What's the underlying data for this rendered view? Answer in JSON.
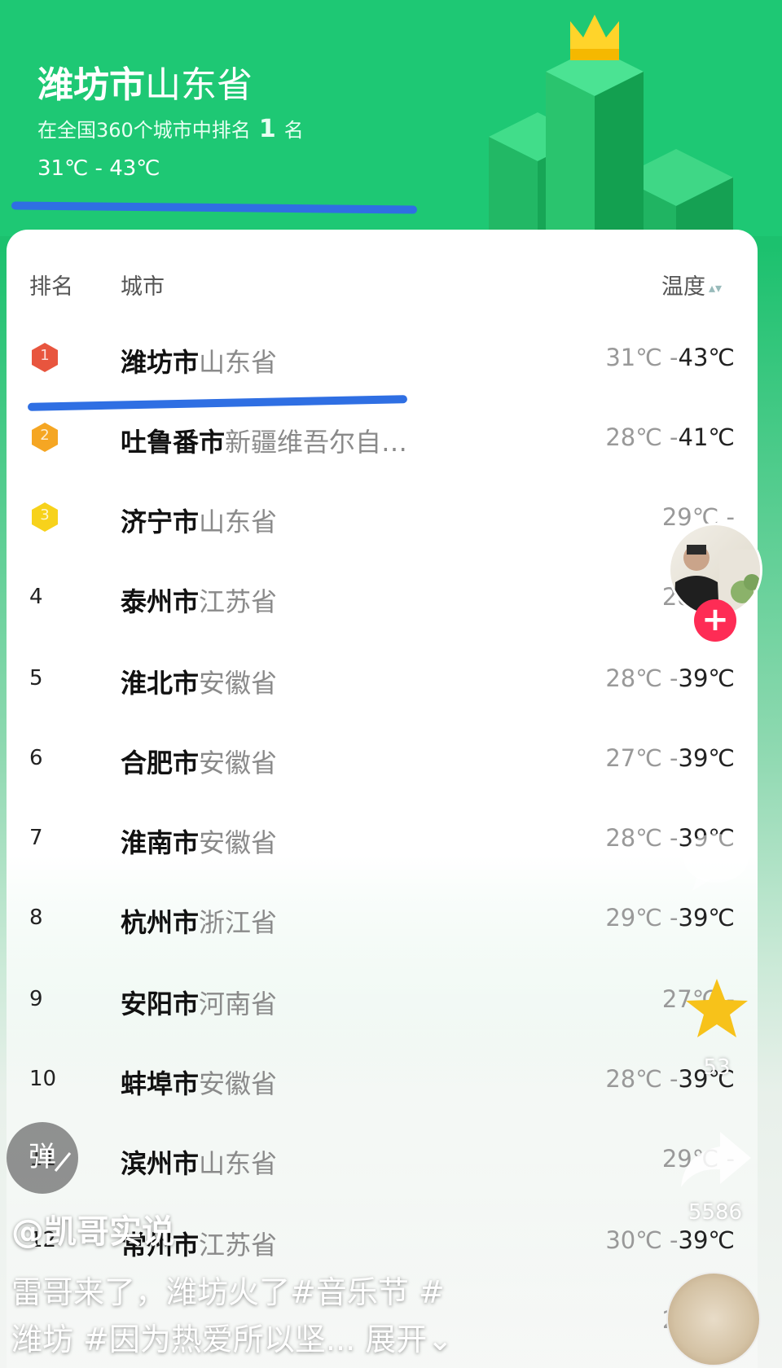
{
  "header": {
    "city": "潍坊市",
    "province": "山东省",
    "rank_prefix": "在全国360个城市中排名",
    "rank_value": "1",
    "rank_suffix": "名",
    "temp_range": "31℃ - 43℃"
  },
  "table": {
    "headers": {
      "rank": "排名",
      "city": "城市",
      "temp": "温度"
    },
    "rows": [
      {
        "rank": "1",
        "city": "潍坊市",
        "province": "山东省",
        "low": "31℃ -",
        "high": "43℃",
        "medal": "#e8553e"
      },
      {
        "rank": "2",
        "city": "吐鲁番市",
        "province": "新疆维吾尔自…",
        "low": "28℃ -",
        "high": "41℃",
        "medal": "#f5a623"
      },
      {
        "rank": "3",
        "city": "济宁市",
        "province": "山东省",
        "low": "29℃ -",
        "high": "",
        "medal": "#f7d21b"
      },
      {
        "rank": "4",
        "city": "泰州市",
        "province": "江苏省",
        "low": "28℃ -",
        "high": ""
      },
      {
        "rank": "5",
        "city": "淮北市",
        "province": "安徽省",
        "low": "28℃ -",
        "high": "39℃"
      },
      {
        "rank": "6",
        "city": "合肥市",
        "province": "安徽省",
        "low": "27℃ -",
        "high": "39℃"
      },
      {
        "rank": "7",
        "city": "淮南市",
        "province": "安徽省",
        "low": "28℃ -",
        "high": "39℃"
      },
      {
        "rank": "8",
        "city": "杭州市",
        "province": "浙江省",
        "low": "29℃ -",
        "high": "39℃"
      },
      {
        "rank": "9",
        "city": "安阳市",
        "province": "河南省",
        "low": "27℃ -",
        "high": ""
      },
      {
        "rank": "10",
        "city": "蚌埠市",
        "province": "安徽省",
        "low": "28℃ -",
        "high": "39℃"
      },
      {
        "rank": "11",
        "city": "滨州市",
        "province": "山东省",
        "low": "29℃ -",
        "high": ""
      },
      {
        "rank": "12",
        "city": "常州市",
        "province": "江苏省",
        "low": "30℃ -",
        "high": "39℃"
      },
      {
        "rank": "",
        "city": "",
        "province": "",
        "low": "27℃ -",
        "high": ""
      }
    ]
  },
  "overlay": {
    "star_count": "53",
    "share_count": "5586",
    "danmu_label": "弹",
    "follow_label": "+",
    "author": "@凯哥实说",
    "caption_line1": "雷哥来了，潍坊火了#音乐节 #",
    "caption_line2": "潍坊 #因为热爱所以坚... 展开⌄"
  },
  "colors": {
    "green": "#1ec874",
    "blue_mark": "#2f6fe3",
    "star": "#f7c21a",
    "follow": "#fe2c55"
  }
}
